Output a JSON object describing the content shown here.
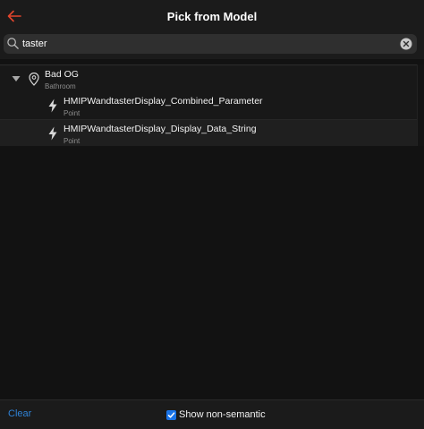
{
  "navbar": {
    "title": "Pick from Model",
    "back_icon": "arrow-left-icon",
    "accent_color": "#e2452c"
  },
  "search": {
    "value": "taster",
    "placeholder": "Search"
  },
  "tree": {
    "group": {
      "label": "Bad OG",
      "subtitle": "Bathroom",
      "icon": "location-pin-icon",
      "expanded": true
    },
    "items": [
      {
        "label": "HMIPWandtasterDisplay_Combined_Parameter",
        "subtitle": "Point",
        "icon": "bolt-icon"
      },
      {
        "label": "HMIPWandtasterDisplay_Display_Data_String",
        "subtitle": "Point",
        "icon": "bolt-icon"
      }
    ]
  },
  "toolbar": {
    "clear_label": "Clear",
    "show_non_semantic_label": "Show non-semantic",
    "show_non_semantic_checked": true,
    "link_color": "#2f82d6"
  }
}
